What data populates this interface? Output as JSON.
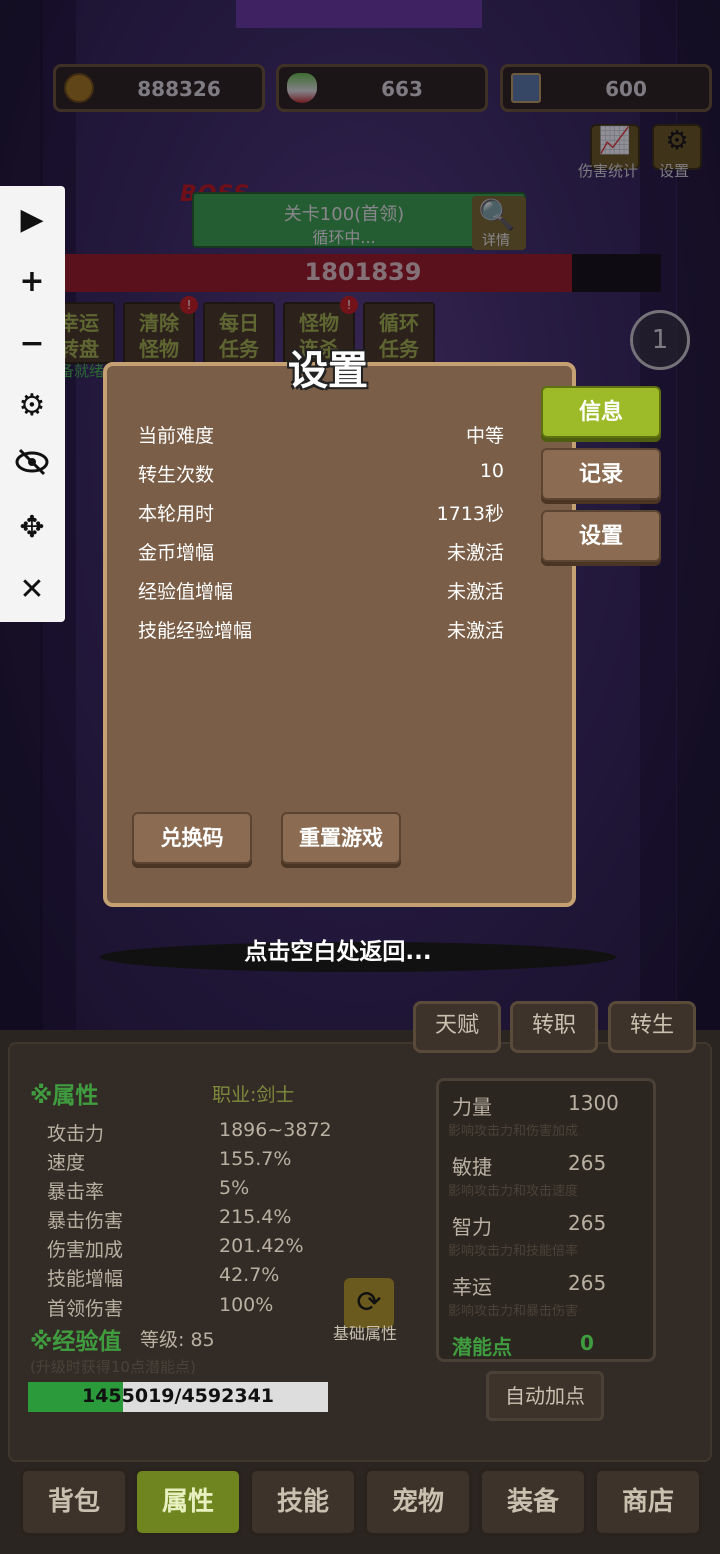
{
  "currency": {
    "gold": "888326",
    "egg": "663",
    "card": "600"
  },
  "top_buttons": {
    "damage_stats": "伤害统计",
    "settings": "设置"
  },
  "toolbar": {
    "icons": [
      "play-icon",
      "plus-icon",
      "minus-icon",
      "gear-icon",
      "eye-off-icon",
      "move-icon",
      "close-icon"
    ]
  },
  "stage": {
    "boss_tag": "BOSS",
    "title": "关卡100(首领)",
    "status": "循环中...",
    "detail_label": "详情",
    "boss_hp": "1801839",
    "boss_hp_fraction": 0.85
  },
  "functions": [
    {
      "line1": "幸运",
      "line2": "转盘"
    },
    {
      "line1": "清除",
      "line2": "怪物"
    },
    {
      "line1": "每日",
      "line2": "任务"
    },
    {
      "line1": "怪物",
      "line2": "连杀"
    },
    {
      "line1": "循环",
      "line2": "任务"
    }
  ],
  "ready_text": "准备就绪",
  "target_count": "1",
  "dialog": {
    "title": "设置",
    "rows": [
      {
        "label": "当前难度",
        "value": "中等"
      },
      {
        "label": "转生次数",
        "value": "10"
      },
      {
        "label": "本轮用时",
        "value": "1713秒"
      },
      {
        "label": "金币增幅",
        "value": "未激活"
      },
      {
        "label": "经验值增幅",
        "value": "未激活"
      },
      {
        "label": "技能经验增幅",
        "value": "未激活"
      }
    ],
    "redeem_button": "兑换码",
    "reset_button": "重置游戏",
    "side_tabs": [
      "信息",
      "记录",
      "设置"
    ]
  },
  "hint": "点击空白处返回...",
  "char_tabs": [
    "天赋",
    "转职",
    "转生"
  ],
  "attributes": {
    "section_title": "※属性",
    "job": "职业:剑士",
    "items": [
      {
        "label": "攻击力",
        "value": "1896~3872"
      },
      {
        "label": "速度",
        "value": "155.7%"
      },
      {
        "label": "暴击率",
        "value": "5%"
      },
      {
        "label": "暴击伤害",
        "value": "215.4%"
      },
      {
        "label": "伤害加成",
        "value": "201.42%"
      },
      {
        "label": "技能增幅",
        "value": "42.7%"
      },
      {
        "label": "首领伤害",
        "value": "100%"
      }
    ]
  },
  "experience": {
    "section_title": "※经验值",
    "level": "等级: 85",
    "hint": "(升级时获得10点潜能点)",
    "progress_text": "1455019/4592341",
    "progress_fraction": 0.317
  },
  "base_attr_label": "基础属性",
  "stats": [
    {
      "name": "力量",
      "value": "1300",
      "desc": "影响攻击力和伤害加成"
    },
    {
      "name": "敏捷",
      "value": "265",
      "desc": "影响攻击力和攻击速度"
    },
    {
      "name": "智力",
      "value": "265",
      "desc": "影响攻击力和技能倍率"
    },
    {
      "name": "幸运",
      "value": "265",
      "desc": "影响攻击力和暴击伤害"
    }
  ],
  "potential": {
    "label": "潜能点",
    "value": "0"
  },
  "auto_button": "自动加点",
  "nav": [
    "背包",
    "属性",
    "技能",
    "宠物",
    "装备",
    "商店"
  ],
  "colors": {
    "accent_green": "#9dbb28",
    "boss_red": "#c4161c",
    "hp_red": "#9b1b23",
    "exp_green": "#2a9a3a"
  }
}
